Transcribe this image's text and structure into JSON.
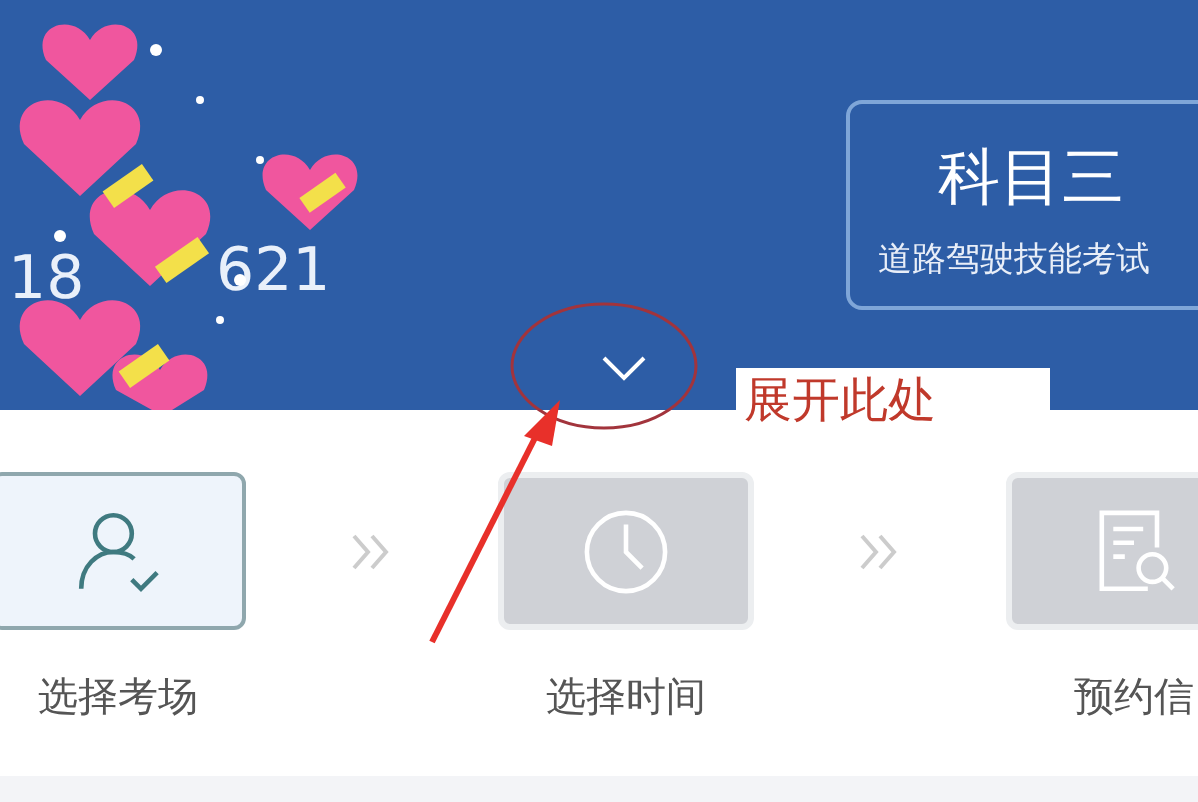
{
  "header": {
    "covered_texts": [
      "18",
      "621"
    ],
    "subject_card": {
      "title": "科目三",
      "subtitle": "道路驾驶技能考试"
    },
    "expand_toggle": {
      "expanded": false
    }
  },
  "annotation": {
    "note": "展开此处"
  },
  "steps": [
    {
      "label": "选择考场",
      "kind": "person",
      "selected": true
    },
    {
      "label": "选择时间",
      "kind": "clock",
      "selected": false
    },
    {
      "label": "预约信",
      "kind": "document",
      "selected": false
    }
  ]
}
